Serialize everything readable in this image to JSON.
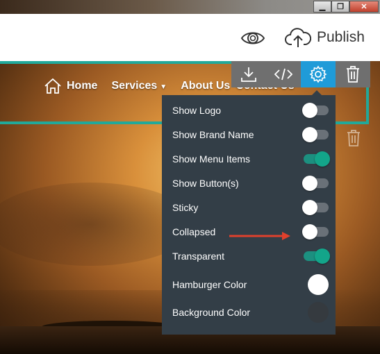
{
  "window": {
    "minimize": "▁",
    "maximize": "❐",
    "close": "✕"
  },
  "topbar": {
    "publish_label": "Publish"
  },
  "nav": {
    "items": [
      {
        "label": "Home"
      },
      {
        "label": "Services"
      },
      {
        "label": "About Us"
      },
      {
        "label": "Contact Us"
      }
    ]
  },
  "toolbar": {
    "active": "settings-button"
  },
  "settings": {
    "rows": [
      {
        "label": "Show Logo",
        "type": "toggle",
        "on": false
      },
      {
        "label": "Show Brand Name",
        "type": "toggle",
        "on": false
      },
      {
        "label": "Show Menu Items",
        "type": "toggle",
        "on": true
      },
      {
        "label": "Show Button(s)",
        "type": "toggle",
        "on": false
      },
      {
        "label": "Sticky",
        "type": "toggle",
        "on": false
      },
      {
        "label": "Collapsed",
        "type": "toggle",
        "on": false
      },
      {
        "label": "Transparent",
        "type": "toggle",
        "on": true
      },
      {
        "label": "Hamburger Color",
        "type": "color",
        "color": "#ffffff"
      },
      {
        "label": "Background Color",
        "type": "color",
        "color": "#353a3f"
      }
    ]
  },
  "colors": {
    "teal": "#21a99a",
    "active_tool": "#1f9bd8",
    "panel": "#333e47",
    "arrow": "#e0402c"
  }
}
